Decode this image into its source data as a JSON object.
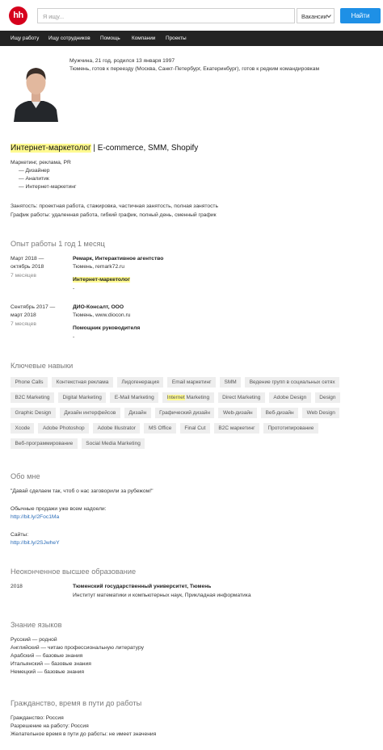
{
  "header": {
    "logo": "hh",
    "search_placeholder": "Я ищу...",
    "category": "Вакансии",
    "find_label": "Найти"
  },
  "nav": [
    "Ищу работу",
    "Ищу сотрудников",
    "Помощь",
    "Компании",
    "Проекты"
  ],
  "profile": {
    "meta": "Мужчина, 21 год, родился 13 января 1997",
    "location": "Тюмень, готов к переезду (Москва, Санкт-Петербург, Екатеринбург), готов к редким командировкам"
  },
  "position": {
    "title_highlight": "Интернет-маркетолог",
    "title_rest": " | E-commerce, SMM, Shopify",
    "field": "Маркетинг, реклама, PR",
    "specializations": [
      "— Дизайнер",
      "— Аналитик",
      "— Интернет-маркетинг"
    ],
    "employment": "Занятость: проектная работа, стажировка, частичная занятость, полная занятость",
    "schedule": "График работы: удаленная работа, гибкий график, полный день, сменный график"
  },
  "experience": {
    "heading": "Опыт работы 1 год 1 месяц",
    "jobs": [
      {
        "period1": "Март 2018 —",
        "period2": "октябрь 2018",
        "duration": "7 месяцев",
        "company": "Ремарк, Интерактивное агентство",
        "details": "Тюмень, remark72.ru",
        "role": "Интернет-маркетолог",
        "note": "-"
      },
      {
        "period1": "Сентябрь 2017 —",
        "period2": "март 2018",
        "duration": "7 месяцев",
        "company": "ДИО-Консалт, ООО",
        "details": "Тюмень, www.diocon.ru",
        "role": "Помощник руководителя",
        "note": "-"
      }
    ]
  },
  "skills": {
    "heading": "Ключевые навыки",
    "rows": [
      [
        "Phone Calls",
        "Контекстная реклама",
        "Лидогенерация",
        "Email маркетинг",
        "SMM",
        "Ведение групп в социальных сетях"
      ],
      [
        "B2C Marketing",
        "Digital Marketing",
        "E-Mail Marketing",
        "Internet Marketing",
        "Direct Marketing",
        "Adobe Design",
        "Design"
      ],
      [
        "Graphic Design",
        "Дизайн интерфейсов",
        "Дизайн",
        "Графический дизайн",
        "Web-дизайн",
        "Веб-дизайн",
        "Web Design"
      ],
      [
        "Xcode",
        "Adobe Photoshop",
        "Adobe Illustrator",
        "MS Office",
        "Final Cut",
        "B2C маркетинг",
        "Прототипирование"
      ],
      [
        "Веб-программирование",
        "Social Media Marketing"
      ]
    ],
    "highlight_prefix": "Internet"
  },
  "about": {
    "heading": "Обо мне",
    "quote": "\"Давай сделаем так, чтоб о нас заговорили за рубежом!\"",
    "sales_label": "Обычные продажи уже всем надоели:",
    "sales_link": "http://bit.ly/2Foc1Ma",
    "sites_label": "Сайты:",
    "sites_link": "http://bit.ly/2SJwheY"
  },
  "education": {
    "heading": "Неоконченное высшее образование",
    "year": "2018",
    "institution": "Тюменский государственный университет, Тюмень",
    "faculty": "Институт математики и компьютерных наук, Прикладная информатика"
  },
  "languages": {
    "heading": "Знание языков",
    "items": [
      "Русский — родной",
      "Английский — читаю профессиональную литературу",
      "Арабский — базовые знания",
      "Итальянский — базовые знания",
      "Немецкий — базовые знания"
    ]
  },
  "citizenship": {
    "heading": "Гражданство, время в пути до работы",
    "items": [
      "Гражданство: Россия",
      "Разрешение на работу: Россия",
      "Желательное время в пути до работы: не имеет значения"
    ]
  },
  "colors": {
    "logo": "#d6001c",
    "button": "#1e90e6",
    "nav_bg": "#232323",
    "highlight": "#fffa90",
    "link": "#2a6cb8"
  }
}
